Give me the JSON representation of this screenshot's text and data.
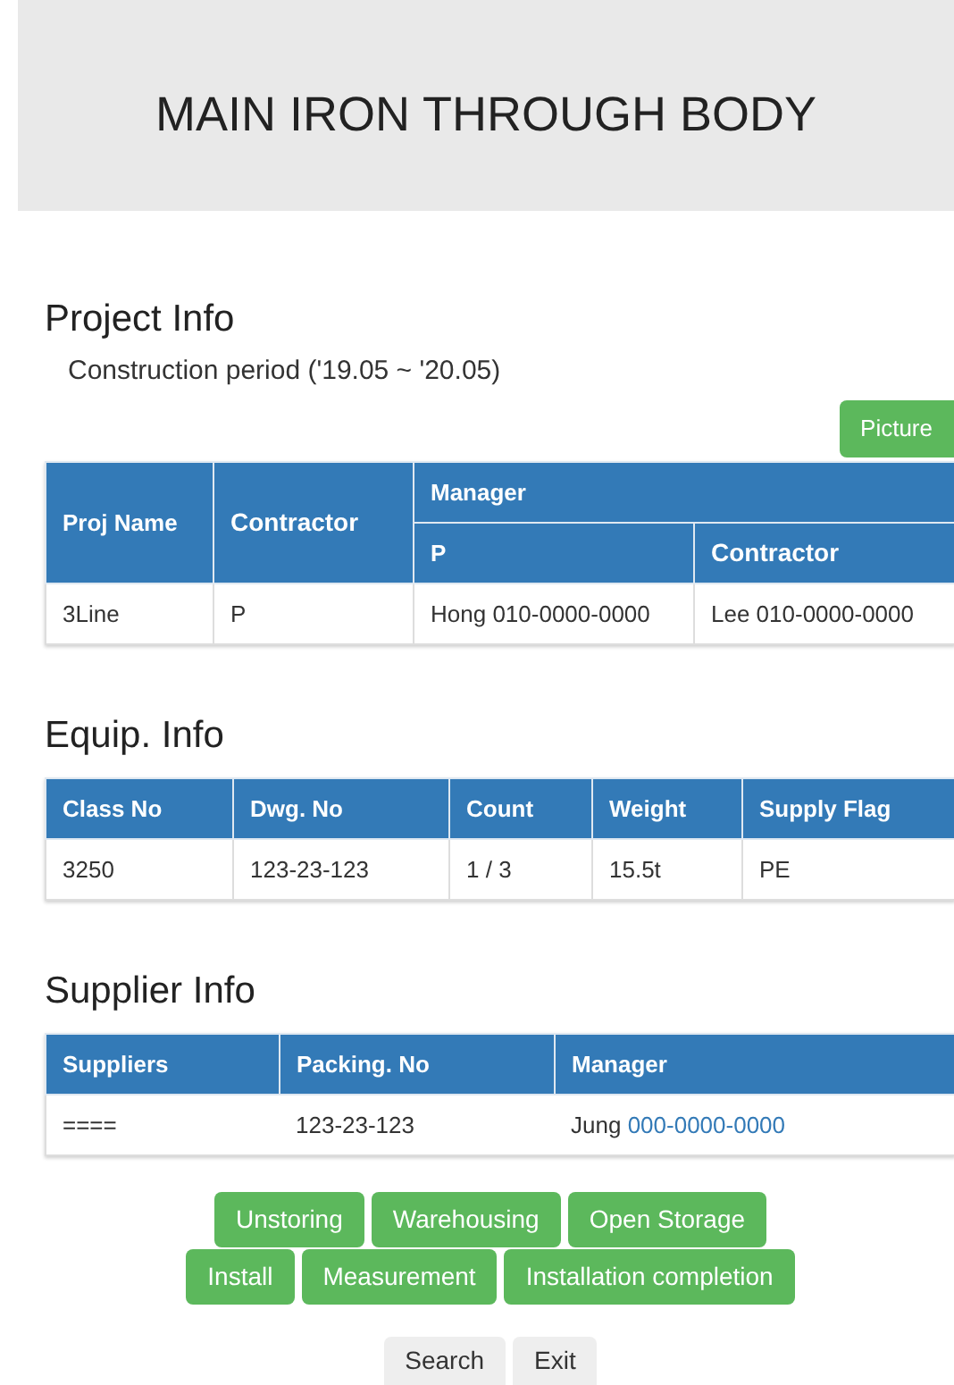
{
  "header": {
    "title": "MAIN IRON THROUGH BODY"
  },
  "project_info": {
    "heading": "Project Info",
    "period": "Construction period ('19.05 ~ '20.05)",
    "picture_button": "Picture",
    "columns": {
      "proj_name": "Proj Name",
      "contractor": "Contractor",
      "manager": "Manager",
      "manager_p": "P",
      "manager_contractor": "Contractor"
    },
    "row": {
      "proj_name": "3Line",
      "contractor": "P",
      "manager_p": "Hong 010-0000-0000",
      "manager_contractor": "Lee 010-0000-0000"
    }
  },
  "equip_info": {
    "heading": "Equip. Info",
    "columns": [
      "Class No",
      "Dwg. No",
      "Count",
      "Weight",
      "Supply Flag"
    ],
    "rows": [
      [
        "3250",
        "123-23-123",
        "1 / 3",
        "15.5t",
        "PE"
      ]
    ]
  },
  "supplier_info": {
    "heading": "Supplier Info",
    "columns": [
      "Suppliers",
      "Packing. No",
      "Manager"
    ],
    "rows": [
      {
        "supplier": "====",
        "packing_no": "123-23-123",
        "manager_name": "Jung",
        "manager_phone": "000-0000-0000"
      }
    ]
  },
  "action_buttons": [
    [
      "Unstoring",
      "Warehousing",
      "Open Storage"
    ],
    [
      "Install",
      "Measurement",
      "Installation completion"
    ]
  ],
  "footer_buttons": [
    "Search",
    "Exit"
  ]
}
